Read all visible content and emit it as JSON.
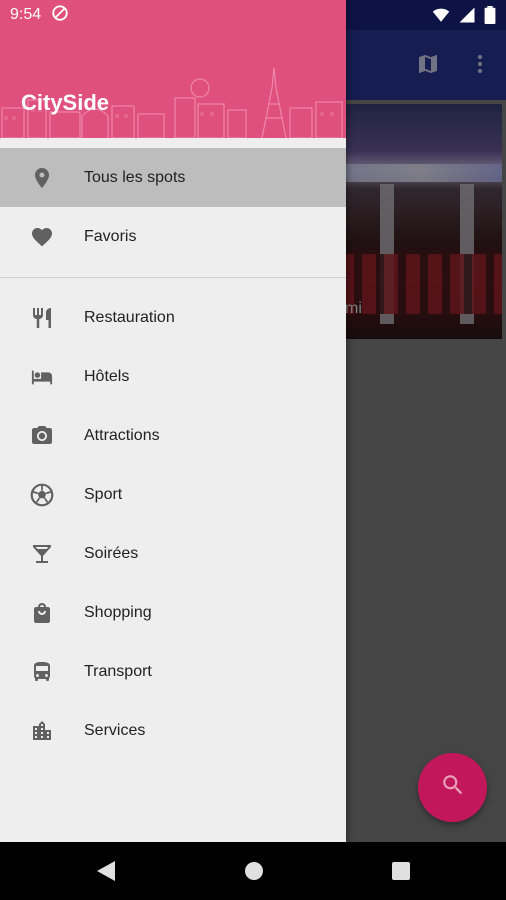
{
  "status_bar": {
    "time": "9:54",
    "icons": [
      "do-not-disturb-icon",
      "wifi-icon",
      "signal-icon",
      "battery-icon"
    ]
  },
  "background": {
    "photo_caption": "mi",
    "appbar_icons": [
      "map-icon",
      "more-vert-icon"
    ],
    "fab_icon": "search-icon",
    "fab_color": "#c2185b"
  },
  "drawer": {
    "title": "CitySide",
    "header_color": "#e0507f",
    "primary_items": [
      {
        "label": "Tous les spots",
        "icon": "location-pin-icon",
        "selected": true
      },
      {
        "label": "Favoris",
        "icon": "heart-icon"
      }
    ],
    "category_items": [
      {
        "label": "Restauration",
        "icon": "restaurant-icon"
      },
      {
        "label": "Hôtels",
        "icon": "hotel-icon"
      },
      {
        "label": "Attractions",
        "icon": "camera-icon"
      },
      {
        "label": "Sport",
        "icon": "soccer-ball-icon"
      },
      {
        "label": "Soirées",
        "icon": "cocktail-icon"
      },
      {
        "label": "Shopping",
        "icon": "shopping-bag-icon"
      },
      {
        "label": "Transport",
        "icon": "bus-icon"
      },
      {
        "label": "Services",
        "icon": "city-buildings-icon"
      }
    ]
  },
  "nav_bar": {
    "buttons": [
      "back-icon",
      "home-icon",
      "recents-icon"
    ]
  }
}
